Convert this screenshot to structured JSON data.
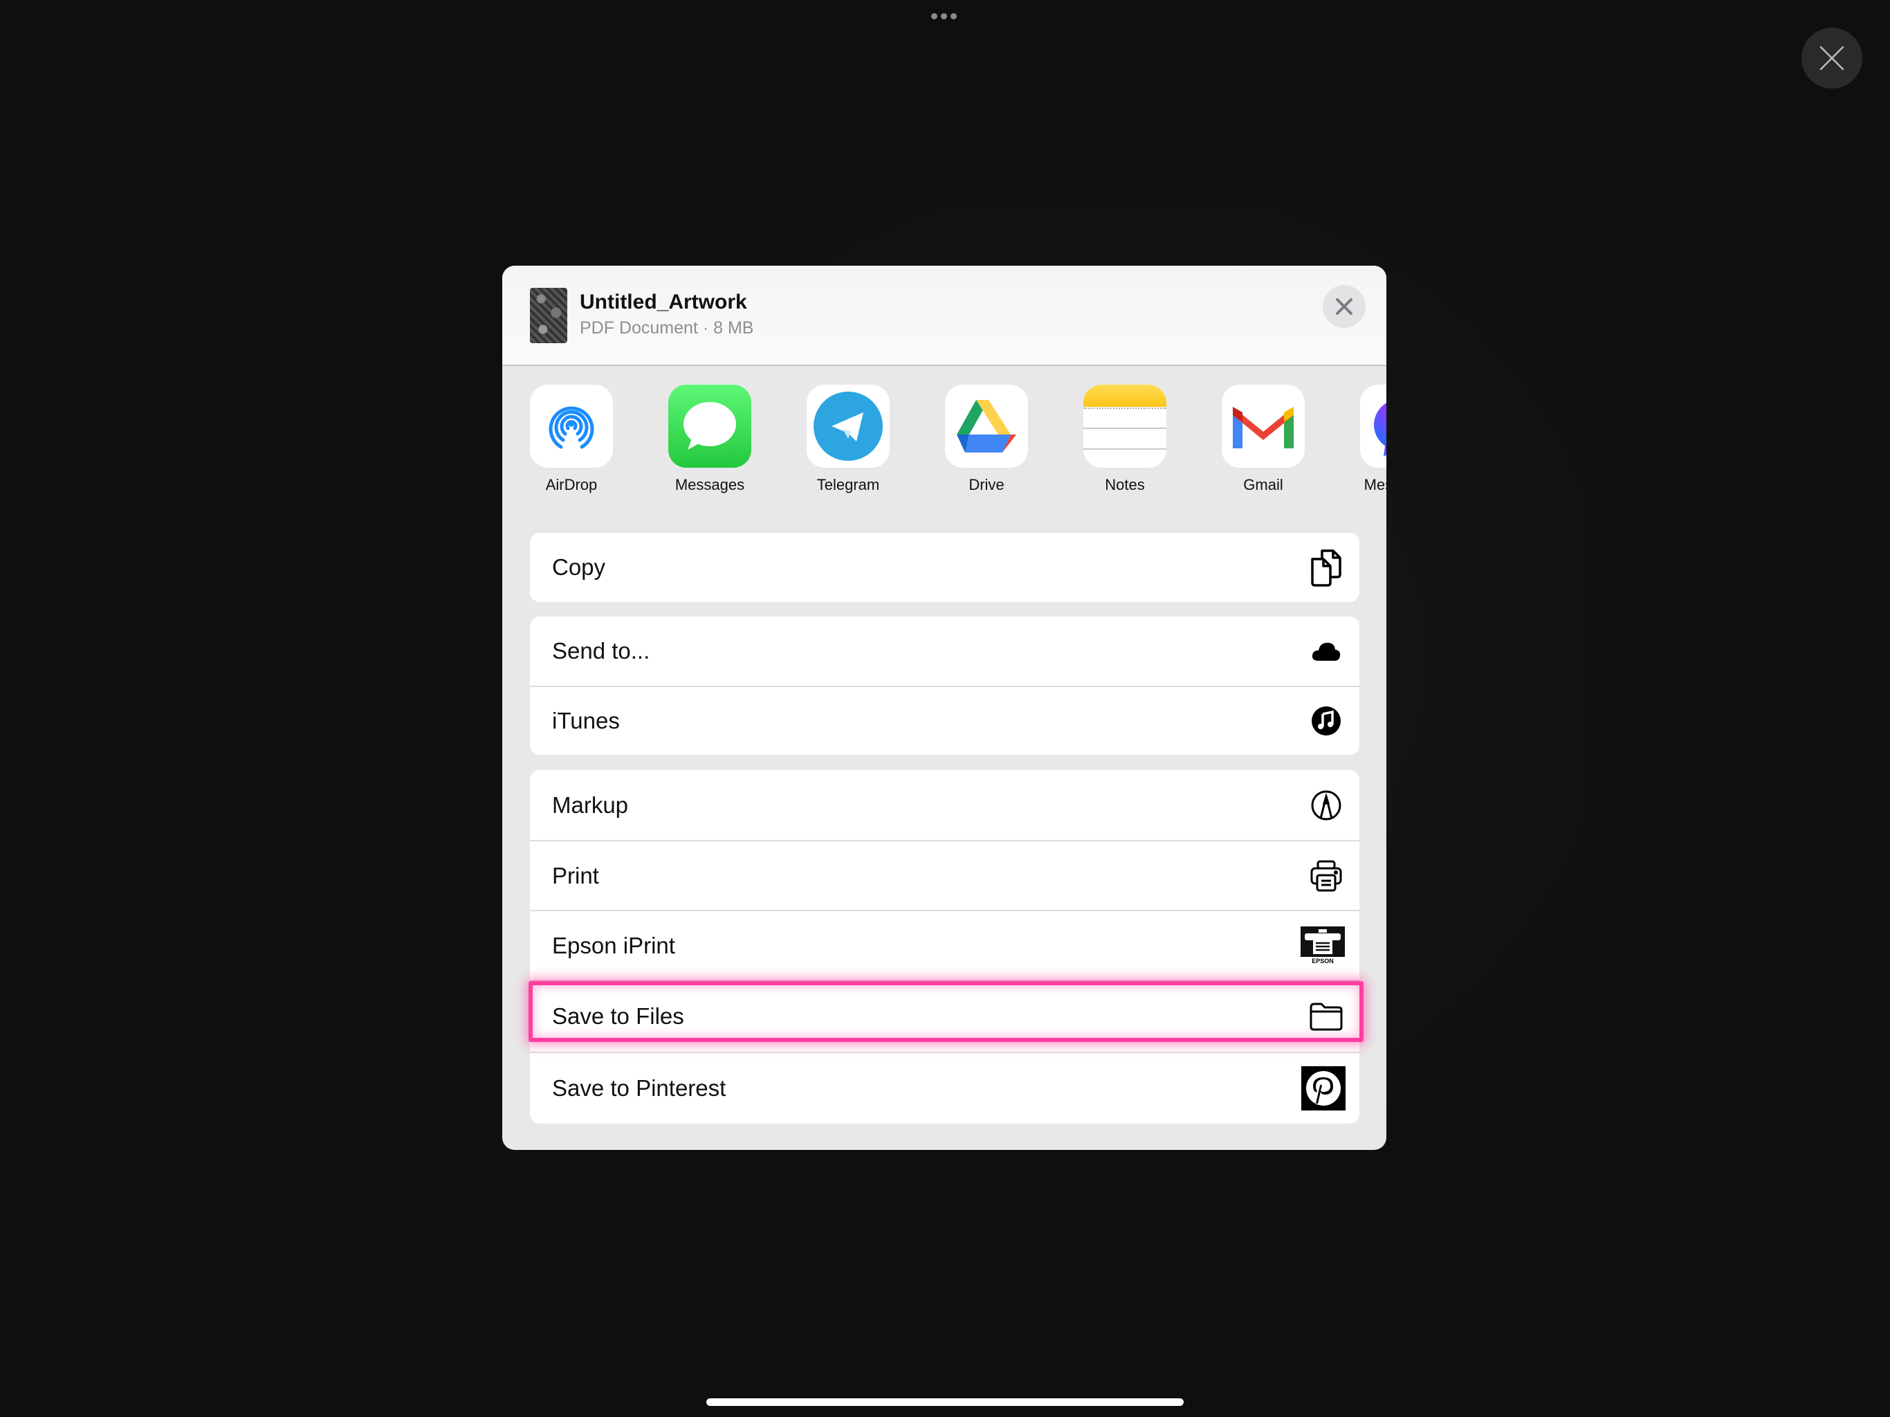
{
  "system": {
    "more_icon": "ellipsis-icon",
    "close_icon": "close-icon"
  },
  "share_sheet": {
    "file": {
      "title": "Untitled_Artwork",
      "subtitle": "PDF Document · 8 MB"
    },
    "apps": [
      {
        "label": "AirDrop",
        "icon": "airdrop-icon"
      },
      {
        "label": "Messages",
        "icon": "messages-icon"
      },
      {
        "label": "Telegram",
        "icon": "telegram-icon"
      },
      {
        "label": "Drive",
        "icon": "google-drive-icon"
      },
      {
        "label": "Notes",
        "icon": "notes-icon"
      },
      {
        "label": "Gmail",
        "icon": "gmail-icon"
      },
      {
        "label": "Messenger",
        "icon": "messenger-icon"
      }
    ],
    "action_groups": [
      [
        {
          "label": "Copy",
          "icon": "copy-icon"
        }
      ],
      [
        {
          "label": "Send to...",
          "icon": "cloud-icon"
        },
        {
          "label": "iTunes",
          "icon": "itunes-icon"
        }
      ],
      [
        {
          "label": "Markup",
          "icon": "markup-icon"
        },
        {
          "label": "Print",
          "icon": "printer-icon"
        },
        {
          "label": "Epson iPrint",
          "icon": "epson-iprint-icon"
        },
        {
          "label": "Save to Files",
          "icon": "folder-icon",
          "highlighted": true
        },
        {
          "label": "Save to Pinterest",
          "icon": "pinterest-icon"
        }
      ]
    ],
    "highlight_color": "#ff3fa0"
  }
}
